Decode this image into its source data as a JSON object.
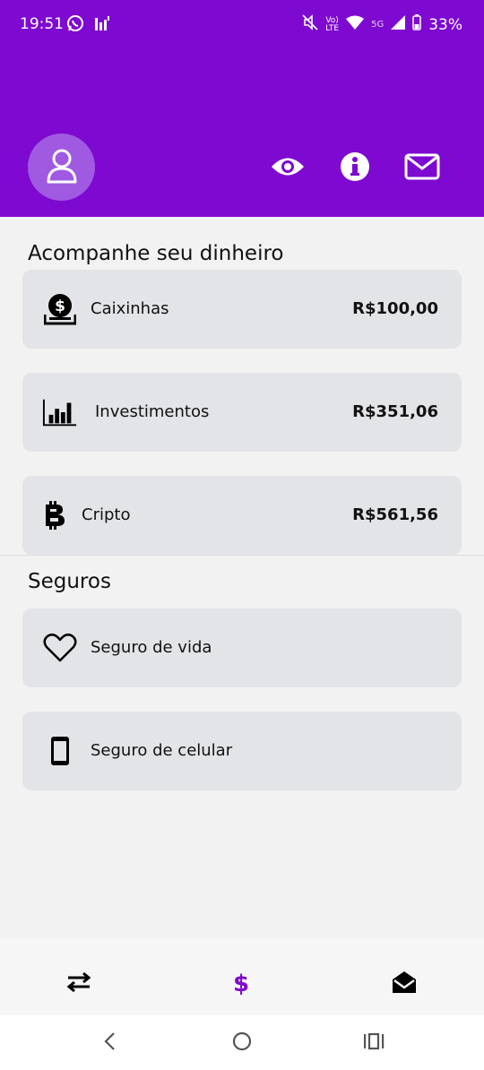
{
  "status_bar": {
    "time": "19:51",
    "battery": "33%",
    "network_label": "5G"
  },
  "header": {
    "avatar_icon": "user-icon",
    "eye_icon": "eye-icon",
    "info_icon": "info-icon",
    "mail_icon": "mail-icon",
    "color": "#7e09d0"
  },
  "money_section": {
    "title": "Acompanhe seu dinheiro",
    "items": [
      {
        "label": "Caixinhas",
        "value": "R$100,00",
        "icon": "savings-box-icon"
      },
      {
        "label": "Investimentos",
        "value": "R$351,06",
        "icon": "bar-chart-icon"
      },
      {
        "label": "Cripto",
        "value": "R$561,56",
        "icon": "bitcoin-icon"
      }
    ]
  },
  "insurance_section": {
    "title": "Seguros",
    "items": [
      {
        "label": "Seguro de vida",
        "icon": "heart-icon"
      },
      {
        "label": "Seguro de celular",
        "icon": "phone-icon"
      }
    ]
  },
  "bottom_nav": {
    "items": [
      {
        "icon": "transfer-arrows-icon"
      },
      {
        "icon": "dollar-icon",
        "active": true
      },
      {
        "icon": "inbox-icon"
      }
    ],
    "active_color": "#7e09d0"
  }
}
